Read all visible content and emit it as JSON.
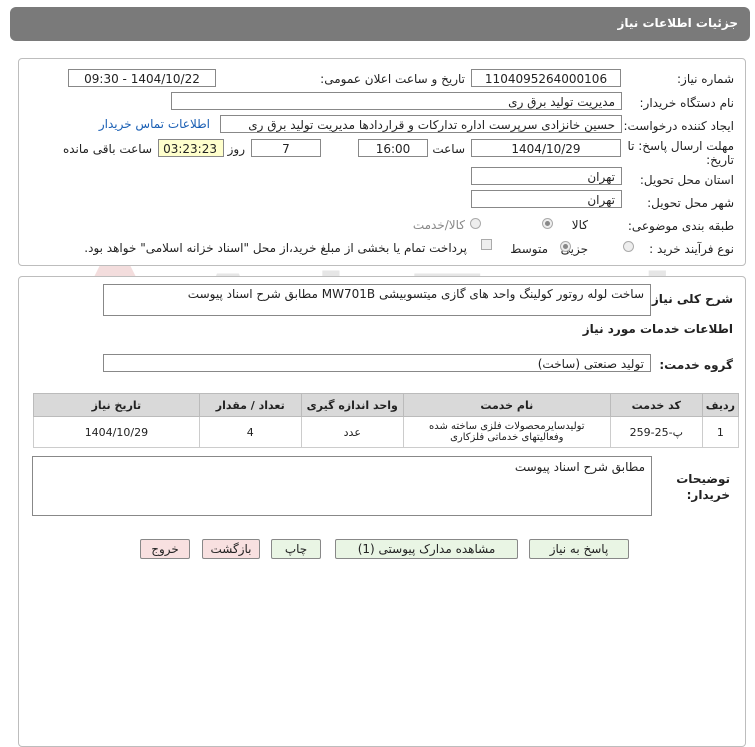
{
  "header": {
    "title": "جزئیات اطلاعات نیاز"
  },
  "form": {
    "need_number_label": "شماره نیاز:",
    "need_number": "1104095264000106",
    "announce_label": "تاریخ و ساعت اعلان عمومی:",
    "announce_value": "1404/10/22 - 09:30",
    "buyer_label": "نام دستگاه خریدار:",
    "buyer_value": "مدیریت تولید برق ری",
    "creator_label": "ایجاد کننده درخواست:",
    "creator_value": "حسین خانزادی سرپرست اداره تدارکات و قراردادها مدیریت تولید برق ری",
    "contact_link": "اطلاعات تماس خریدار",
    "deadline_label_1": "مهلت ارسال پاسخ: تا",
    "deadline_label_2": "تاریخ:",
    "deadline_date": "1404/10/29",
    "time_label": "ساعت",
    "deadline_time": "16:00",
    "days_value": "7",
    "days_label": "روز و",
    "remaining_time": "03:23:23",
    "remaining_label": "ساعت باقی مانده",
    "province_label": "استان محل تحویل:",
    "province_value": "تهران",
    "city_label": "شهر محل تحویل:",
    "city_value": "تهران",
    "category_label": "طبقه بندی موضوعی:",
    "category_options": [
      "کالا",
      "کالا/خدمت"
    ],
    "purchase_type_label": "نوع فرآیند خرید :",
    "purchase_options": [
      "جزیی",
      "متوسط"
    ],
    "payment_note": "پرداخت تمام یا بخشی از مبلغ خرید،از محل \"اسناد خزانه اسلامی\" خواهد بود."
  },
  "need": {
    "summary_label": "شرح کلی نیاز:",
    "summary_value": "ساخت لوله روتور کولینگ واحد های گازی میتسوبیشی MW701B مطابق شرح اسناد پیوست",
    "services_heading": "اطلاعات خدمات مورد نیاز",
    "service_group_label": "گروه خدمت:",
    "service_group_value": "تولید صنعتی (ساخت)"
  },
  "table": {
    "headers": [
      "ردیف",
      "کد خدمت",
      "نام خدمت",
      "واحد اندازه گیری",
      "تعداد / مقدار",
      "تاریخ نیاز"
    ],
    "rows": [
      [
        "1",
        "پ-25-259",
        "تولیدسایرمحصولات فلزی ساخته شده وفعالیتهای خدماتی فلزکاری",
        "عدد",
        "4",
        "1404/10/29"
      ]
    ]
  },
  "notes": {
    "label_1": "توضیحات",
    "label_2": "خریدار:",
    "value": "مطابق شرح اسناد پیوست"
  },
  "buttons": {
    "reply": "پاسخ به نیاز",
    "view_docs": "مشاهده مدارک پیوستی (1)",
    "print": "چاپ",
    "back": "بازگشت",
    "exit": "خروج"
  },
  "watermark": {
    "text": "AriaTender.net"
  },
  "colors": {
    "title_bg": "#7a7a7a",
    "button_bg": "#e9f5e4",
    "exit_bg": "#f8e0e0",
    "link": "#1a5fb4",
    "timer_bg": "#ffffcc"
  }
}
